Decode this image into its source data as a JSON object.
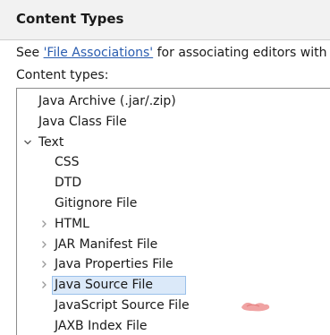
{
  "header": {
    "title": "Content Types"
  },
  "description": {
    "prefix": "See ",
    "link": "'File Associations'",
    "suffix": " for associating editors with"
  },
  "content_types_label": "Content types:",
  "tree": {
    "items": [
      {
        "label": "Java Archive (.jar/.zip)",
        "depth": 0,
        "twisty": ""
      },
      {
        "label": "Java Class File",
        "depth": 0,
        "twisty": ""
      },
      {
        "label": "Text",
        "depth": 0,
        "twisty": "expanded"
      },
      {
        "label": "CSS",
        "depth": 1,
        "twisty": ""
      },
      {
        "label": "DTD",
        "depth": 1,
        "twisty": ""
      },
      {
        "label": "Gitignore File",
        "depth": 1,
        "twisty": ""
      },
      {
        "label": "HTML",
        "depth": 1,
        "twisty": "collapsed"
      },
      {
        "label": "JAR Manifest File",
        "depth": 1,
        "twisty": "collapsed"
      },
      {
        "label": "Java Properties File",
        "depth": 1,
        "twisty": "collapsed"
      },
      {
        "label": "Java Source File",
        "depth": 1,
        "twisty": "collapsed",
        "selected": true
      },
      {
        "label": "JavaScript Source File",
        "depth": 1,
        "twisty": ""
      },
      {
        "label": "JAXB Index File",
        "depth": 1,
        "twisty": ""
      }
    ]
  },
  "icons": {
    "expanded": "chevron-down-icon",
    "collapsed": "chevron-right-icon"
  },
  "colors": {
    "link": "#2a5db0",
    "selection_fill": "#dbe9f9",
    "selection_border": "#9ac0ea",
    "header_bg": "#f2f2f2"
  }
}
